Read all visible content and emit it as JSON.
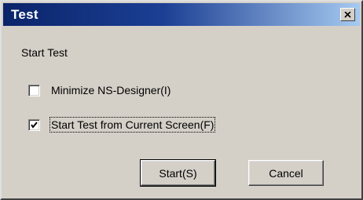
{
  "window": {
    "title": "Test"
  },
  "titlebar": {
    "close_icon": "close-icon"
  },
  "content": {
    "label": "Start Test",
    "checkboxes": [
      {
        "label": "Minimize NS-Designer(I)",
        "checked": false
      },
      {
        "label": "Start Test from Current Screen(F)",
        "checked": true
      }
    ]
  },
  "buttons": {
    "start": "Start(S)",
    "cancel": "Cancel"
  }
}
